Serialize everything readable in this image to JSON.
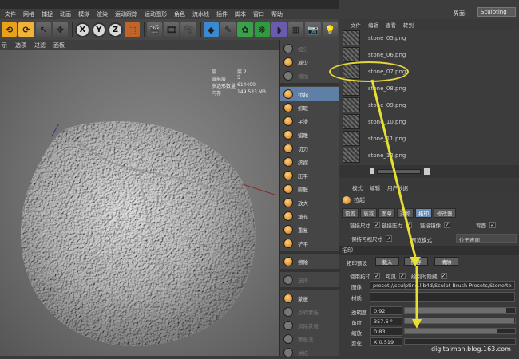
{
  "window": {
    "title": ""
  },
  "menu": [
    "文件",
    "网格",
    "捕捉",
    "动画",
    "模拟",
    "渲染",
    "运动跟踪",
    "运动图形",
    "角色",
    "流水线",
    "插件",
    "脚本",
    "窗口",
    "帮助"
  ],
  "layout": {
    "label": "界面:",
    "value": "Sculpting"
  },
  "toolbar": {
    "axes": [
      "X",
      "Y",
      "Z"
    ]
  },
  "viewport": {
    "menu": [
      "示",
      "选项",
      "过滤",
      "面板"
    ],
    "hud": [
      {
        "k": "层",
        "v": "层 2"
      },
      {
        "k": "当前层",
        "v": "5"
      },
      {
        "k": "多边形数量",
        "v": "614400"
      },
      {
        "k": "内存",
        "v": "149.533 MB"
      }
    ]
  },
  "brushes": {
    "top": [
      "细分",
      "减少",
      "增加"
    ],
    "main": [
      "拉起",
      "抓取",
      "平滑",
      "蜡雕",
      "切刀",
      "挤捏",
      "压平",
      "膨胀",
      "放大",
      "填充",
      "重复",
      "铲平"
    ],
    "mid": [
      "擦除"
    ],
    "mid2": [
      "选择"
    ],
    "bottom": [
      "蒙板",
      "反转蒙板",
      "清除蒙板",
      "蒙板洗",
      "烘焙"
    ]
  },
  "content_browser": {
    "tabs": [
      "文件",
      "编辑",
      "查看",
      "转到"
    ],
    "files": [
      "stone_05.png",
      "stone_06.png",
      "stone_07.png",
      "stone_08.png",
      "stone_09.png",
      "stone_10.png",
      "stone_11.png",
      "stone_12.png"
    ],
    "highlighted": "stone_07.png"
  },
  "attributes": {
    "tabs": [
      "模式",
      "编辑",
      "用户数据"
    ],
    "object": "拉起",
    "subtabs": [
      "设置",
      "衰减",
      "图章",
      "对称",
      "拓印",
      "修改器"
    ],
    "active_subtab": "拓印",
    "checks": [
      {
        "label": "链接尺寸",
        "checked": true
      },
      {
        "label": "链接压力",
        "checked": true
      },
      {
        "label": "链接镜像",
        "checked": true
      },
      {
        "label": "背面",
        "checked": true
      }
    ],
    "keep_size": {
      "label": "保持可视尺寸",
      "checked": true
    },
    "preview_mode": {
      "label": "预览模式",
      "value": "位于表面"
    },
    "section": "拓印",
    "preset_label": "拓印预设",
    "preset_buttons": [
      "载入",
      "保存",
      "清除"
    ],
    "use_stamp": {
      "label": "使用拓印",
      "checked": true
    },
    "visible": {
      "label": "可见",
      "checked": true
    },
    "draw_hide": {
      "label": "绘制时隐藏",
      "checked": true
    },
    "image_label": "图像",
    "image_path": "preset://sculpting.lib4d/Sculpt Brush Presets/Stone/te",
    "material_label": "材质",
    "params": [
      {
        "label": "透明度",
        "value": "0.92",
        "fill": 0.92
      },
      {
        "label": "角度",
        "value": "357.6 °",
        "fill": 0.99
      },
      {
        "label": "缩放",
        "value": "0.83",
        "fill": 0.83
      },
      {
        "label": "变化",
        "value": "X 0.519",
        "fill": 0.0
      }
    ]
  },
  "watermark": "digitalman.blog.163.com",
  "colors": {
    "highlight_ellipse": "#e5d63a",
    "arrow": "#e8e030",
    "selected": "#5e7fa6"
  }
}
